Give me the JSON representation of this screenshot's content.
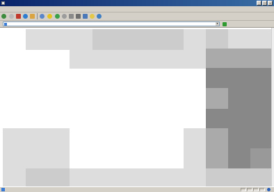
{
  "window": {
    "title": ""
  },
  "menu": {
    "items": [
      "",
      "",
      "",
      "",
      "",
      ""
    ]
  },
  "toolbar": {
    "back_label": "",
    "search_label": "",
    "favorites_label": ""
  },
  "address": {
    "label": "",
    "url": "",
    "go_label": "",
    "links_label": ""
  },
  "status": {
    "text": "",
    "zone": ""
  },
  "colors": {
    "title_gradient_start": "#0a246a",
    "title_gradient_end": "#3a6ea5",
    "chrome": "#d4d0c8",
    "placeholder_light": "#dddddd",
    "placeholder_mid": "#cccccc",
    "placeholder_dark": "#888888"
  },
  "icons": {
    "back": "back-arrow-icon",
    "forward": "forward-arrow-icon",
    "stop": "stop-icon",
    "refresh": "refresh-icon",
    "home": "home-icon",
    "search": "search-icon",
    "favorites": "star-icon",
    "media": "media-icon",
    "history": "history-icon",
    "mail": "mail-icon",
    "print": "print-icon",
    "edit": "edit-icon",
    "messenger": "messenger-icon",
    "go": "go-arrow-icon",
    "page": "page-icon",
    "zone": "internet-zone-icon"
  }
}
